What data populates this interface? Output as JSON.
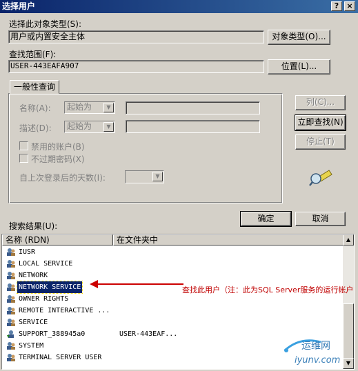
{
  "window": {
    "title": "选择用户",
    "help_btn": "?",
    "close_btn": "×"
  },
  "object_type": {
    "label": "选择此对象类型(S):",
    "value": "用户或内置安全主体",
    "button": "对象类型(O)..."
  },
  "location": {
    "label": "查找范围(F):",
    "value": "USER-443EAFA907",
    "button": "位置(L)..."
  },
  "tab": {
    "label": "一般性查询"
  },
  "query": {
    "name_label": "名称(A):",
    "name_mode": "起始为",
    "desc_label": "描述(D):",
    "desc_mode": "起始为",
    "disabled_accounts": "禁用的账户(B)",
    "no_expire_pwd": "不过期密码(X)",
    "days_since_logon": "自上次登录后的天数(I):"
  },
  "buttons": {
    "columns": "列(C)...",
    "find_now": "立即查找(N)",
    "stop": "停止(T)",
    "ok": "确定",
    "cancel": "取消"
  },
  "results": {
    "label": "搜索结果(U):",
    "col_name": "名称 (RDN)",
    "col_folder": "在文件夹中",
    "rows": [
      {
        "name": "IUSR",
        "folder": ""
      },
      {
        "name": "LOCAL SERVICE",
        "folder": ""
      },
      {
        "name": "NETWORK",
        "folder": ""
      },
      {
        "name": "NETWORK SERVICE",
        "folder": "",
        "selected": true
      },
      {
        "name": "OWNER RIGHTS",
        "folder": ""
      },
      {
        "name": "REMOTE INTERACTIVE ...",
        "folder": ""
      },
      {
        "name": "SERVICE",
        "folder": ""
      },
      {
        "name": "SUPPORT_388945a0",
        "folder": "USER-443EAF..."
      },
      {
        "name": "SYSTEM",
        "folder": ""
      },
      {
        "name": "TERMINAL SERVER USER",
        "folder": ""
      }
    ]
  },
  "annotation": {
    "text": "查找此用户（注：此为SQL  Server服务的运行帐户",
    "color": "#cc0000"
  },
  "watermark": {
    "site": "运维网",
    "url": "iyunv.com"
  },
  "colors": {
    "title_bar": "#0a246a",
    "selection": "#0a246a",
    "dialog_bg": "#d4d0c8",
    "annotation": "#cc0000"
  }
}
